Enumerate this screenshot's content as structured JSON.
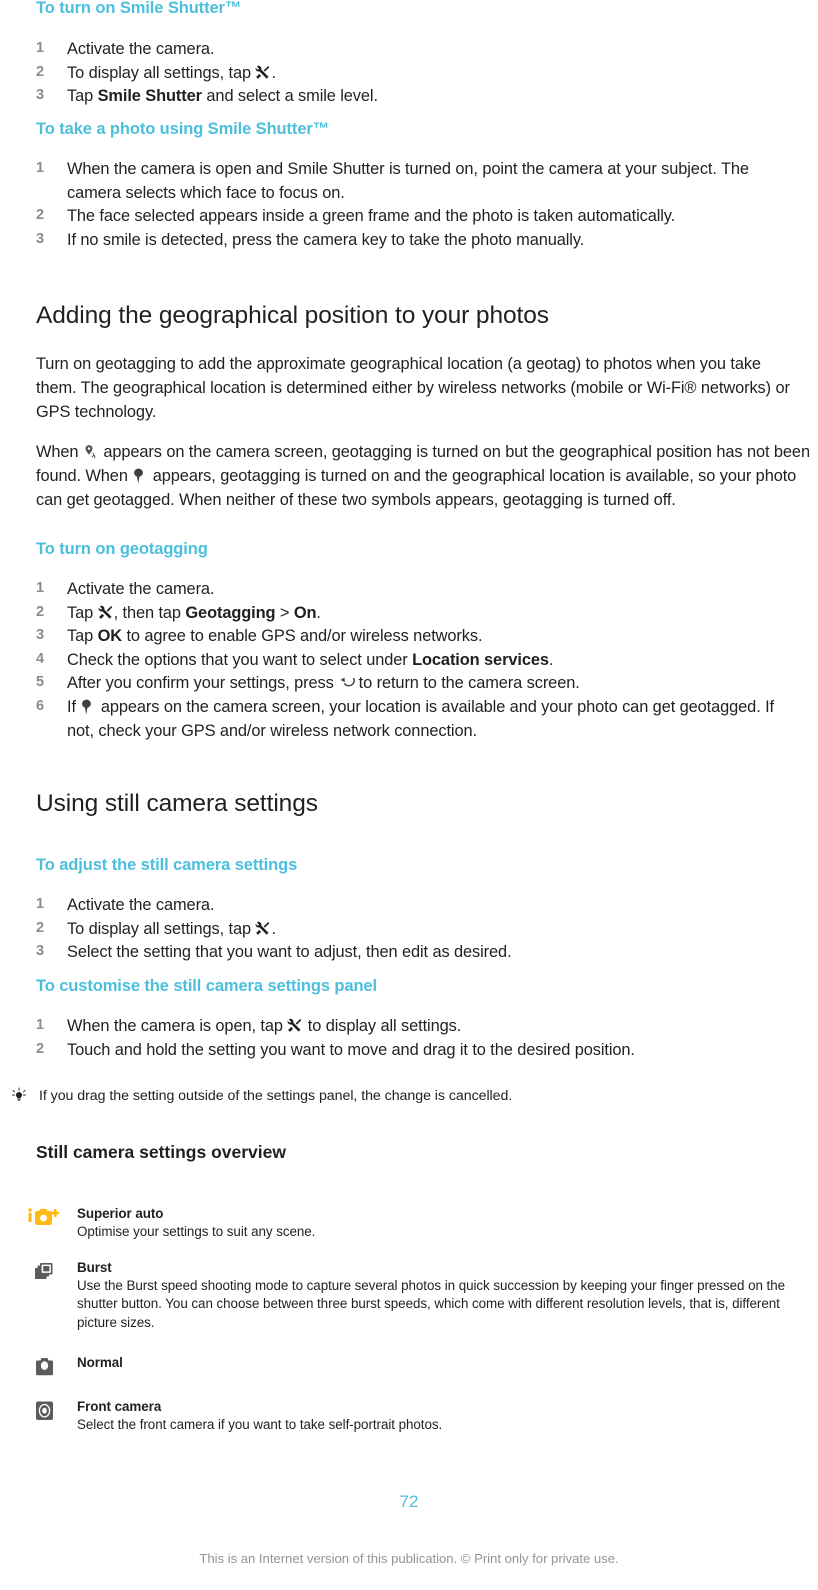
{
  "page": {
    "number": "72",
    "footnote": "This is an Internet version of this publication. © Print only for private use.",
    "accent_color": "#4bbfdd",
    "text_color": "#231f20",
    "step_number_color": "#8b8b8b",
    "footnote_color": "#939598",
    "superior_auto_icon_color": "#fdbb13"
  },
  "sections": {
    "smile_shutter_on": {
      "heading": "To turn on Smile Shutter™",
      "steps": [
        {
          "parts": [
            {
              "t": "text",
              "v": "Activate the camera."
            }
          ]
        },
        {
          "parts": [
            {
              "t": "text",
              "v": "To display all settings, tap "
            },
            {
              "t": "icon",
              "v": "settings-tools-icon"
            },
            {
              "t": "text",
              "v": "."
            }
          ]
        },
        {
          "parts": [
            {
              "t": "text",
              "v": "Tap "
            },
            {
              "t": "bold",
              "v": "Smile Shutter"
            },
            {
              "t": "text",
              "v": " and select a smile level."
            }
          ]
        }
      ]
    },
    "smile_shutter_photo": {
      "heading": "To take a photo using Smile Shutter™",
      "steps": [
        {
          "parts": [
            {
              "t": "text",
              "v": "When the camera is open and Smile Shutter is turned on, point the camera at your subject. The camera selects which face to focus on."
            }
          ]
        },
        {
          "parts": [
            {
              "t": "text",
              "v": "The face selected appears inside a green frame and the photo is taken automatically."
            }
          ]
        },
        {
          "parts": [
            {
              "t": "text",
              "v": "If no smile is detected, press the camera key to take the photo manually."
            }
          ]
        }
      ]
    },
    "geotag": {
      "title": "Adding the geographical position to your photos",
      "paragraph1": "Turn on geotagging to add the approximate geographical location (a geotag) to photos when you take them. The geographical location is determined either by wireless networks (mobile or Wi-Fi® networks) or GPS technology.",
      "paragraph2_parts": [
        {
          "t": "text",
          "v": "When "
        },
        {
          "t": "icon",
          "v": "geotag-searching-icon"
        },
        {
          "t": "text",
          "v": " appears on the camera screen, geotagging is turned on but the geographical position has not been found. When "
        },
        {
          "t": "icon",
          "v": "geotag-found-pin-icon"
        },
        {
          "t": "text",
          "v": " appears, geotagging is turned on and the geographical location is available, so your photo can get geotagged. When neither of these two symbols appears, geotagging is turned off."
        }
      ],
      "heading": "To turn on geotagging",
      "steps": [
        {
          "parts": [
            {
              "t": "text",
              "v": "Activate the camera."
            }
          ]
        },
        {
          "parts": [
            {
              "t": "text",
              "v": "Tap "
            },
            {
              "t": "icon",
              "v": "settings-tools-icon"
            },
            {
              "t": "text",
              "v": ", then tap "
            },
            {
              "t": "bold",
              "v": "Geotagging"
            },
            {
              "t": "text",
              "v": " > "
            },
            {
              "t": "bold",
              "v": "On"
            },
            {
              "t": "text",
              "v": "."
            }
          ]
        },
        {
          "parts": [
            {
              "t": "text",
              "v": "Tap "
            },
            {
              "t": "bold",
              "v": "OK"
            },
            {
              "t": "text",
              "v": " to agree to enable GPS and/or wireless networks."
            }
          ]
        },
        {
          "parts": [
            {
              "t": "text",
              "v": "Check the options that you want to select under "
            },
            {
              "t": "bold",
              "v": "Location services"
            },
            {
              "t": "text",
              "v": "."
            }
          ]
        },
        {
          "parts": [
            {
              "t": "text",
              "v": "After you confirm your settings, press "
            },
            {
              "t": "icon",
              "v": "back-arrow-icon"
            },
            {
              "t": "text",
              "v": " to return to the camera screen."
            }
          ]
        },
        {
          "parts": [
            {
              "t": "text",
              "v": "If "
            },
            {
              "t": "icon",
              "v": "geotag-found-pin-icon"
            },
            {
              "t": "text",
              "v": " appears on the camera screen, your location is available and your photo can get geotagged. If not, check your GPS and/or wireless network connection."
            }
          ]
        }
      ]
    },
    "using_still": {
      "title": "Using still camera settings",
      "adjust": {
        "heading": "To adjust the still camera settings",
        "steps": [
          {
            "parts": [
              {
                "t": "text",
                "v": "Activate the camera."
              }
            ]
          },
          {
            "parts": [
              {
                "t": "text",
                "v": "To display all settings, tap "
              },
              {
                "t": "icon",
                "v": "settings-tools-icon"
              },
              {
                "t": "text",
                "v": "."
              }
            ]
          },
          {
            "parts": [
              {
                "t": "text",
                "v": "Select the setting that you want to adjust, then edit as desired."
              }
            ]
          }
        ]
      },
      "customise": {
        "heading": "To customise the still camera settings panel",
        "steps": [
          {
            "parts": [
              {
                "t": "text",
                "v": "When the camera is open, tap "
              },
              {
                "t": "icon",
                "v": "settings-tools-icon"
              },
              {
                "t": "text",
                "v": " to display all settings."
              }
            ]
          },
          {
            "parts": [
              {
                "t": "text",
                "v": "Touch and hold the setting you want to move and drag it to the desired position."
              }
            ]
          }
        ]
      },
      "tip": "If you drag the setting outside of the settings panel, the change is cancelled."
    },
    "overview": {
      "title": "Still camera settings overview",
      "items": [
        {
          "icon": "superior-auto-camera-icon",
          "title": "Superior auto",
          "desc": "Optimise your settings to suit any scene."
        },
        {
          "icon": "burst-stack-icon",
          "title": "Burst",
          "desc": "Use the Burst speed shooting mode to capture several photos in quick succession by keeping your finger pressed on the shutter button. You can choose between three burst speeds, which come with different resolution levels, that is, different picture sizes."
        },
        {
          "icon": "normal-camera-icon",
          "title": "Normal",
          "desc": ""
        },
        {
          "icon": "front-camera-icon",
          "title": "Front camera",
          "desc": "Select the front camera if you want to take self-portrait photos."
        }
      ]
    }
  }
}
